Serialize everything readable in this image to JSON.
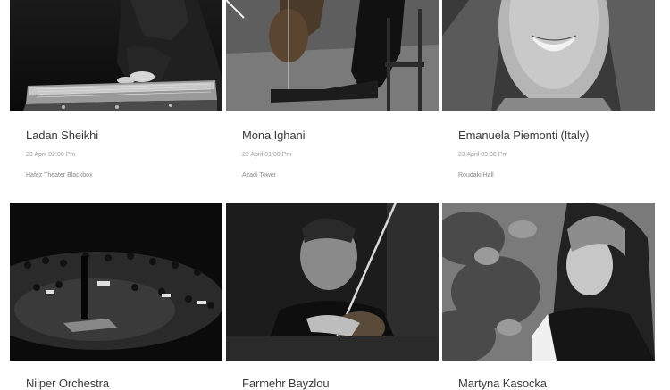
{
  "events": [
    {
      "name": "Ladan Sheikhi",
      "date": "23 April 02:00 Pm",
      "venue": "Hafez Theater Blackbox",
      "photo": "photo-santur-player"
    },
    {
      "name": "Mona Ighani",
      "date": "22 April 01:00 Pm",
      "venue": "Azadi Tower",
      "photo": "photo-cellist"
    },
    {
      "name": "Emanuela Piemonti (Italy)",
      "date": "23 April 09:00 Pm",
      "venue": "Roudaki Hall",
      "photo": "photo-smiling-woman"
    },
    {
      "name": "Nilper Orchestra",
      "date": "",
      "venue": "",
      "photo": "photo-orchestra-stage"
    },
    {
      "name": "Farmehr Bayzlou",
      "date": "",
      "venue": "",
      "photo": "photo-violinist"
    },
    {
      "name": "Martyna Kasocka",
      "date": "",
      "venue": "",
      "photo": "photo-woman-headscarf"
    }
  ]
}
